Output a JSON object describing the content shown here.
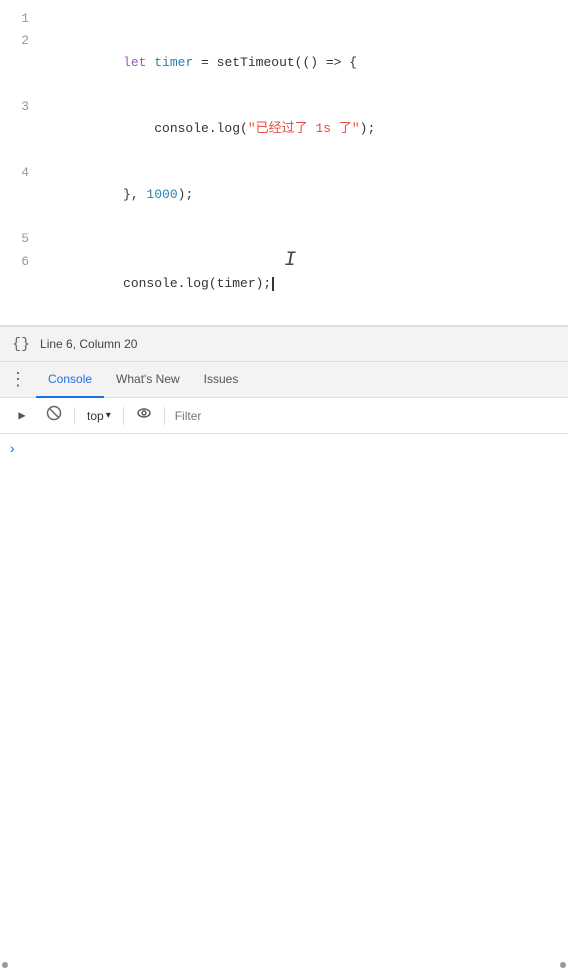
{
  "code": {
    "lines": [
      {
        "number": "1",
        "content": ""
      },
      {
        "number": "2",
        "content": "let timer = setTimeout(() => {"
      },
      {
        "number": "3",
        "content": "    console.log(\"已经过了 1s 了\");"
      },
      {
        "number": "4",
        "content": "}, 1000);"
      },
      {
        "number": "5",
        "content": ""
      },
      {
        "number": "6",
        "content": "console.log(timer);"
      }
    ]
  },
  "statusBar": {
    "text": "Line 6, Column 20"
  },
  "tabs": {
    "items": [
      {
        "label": "Console",
        "active": true
      },
      {
        "label": "What's New",
        "active": false
      },
      {
        "label": "Issues",
        "active": false
      }
    ]
  },
  "toolbar": {
    "topLabel": "top",
    "filterPlaceholder": "Filter"
  },
  "icons": {
    "menuDots": "⋮",
    "play": "▶",
    "block": "⊘",
    "eye": "👁",
    "chevronDown": "▾"
  }
}
